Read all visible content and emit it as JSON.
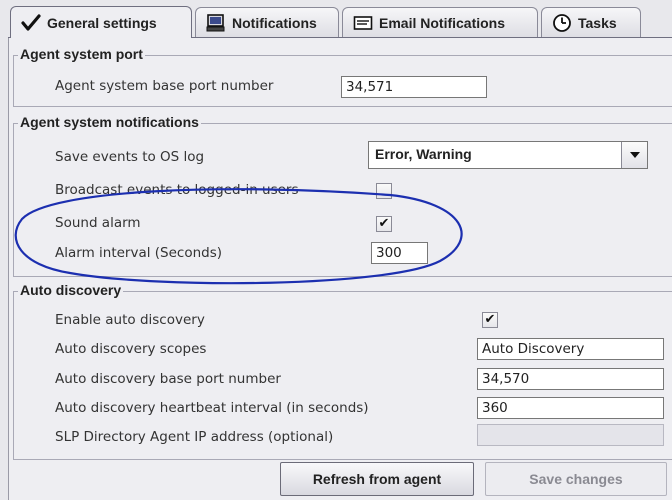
{
  "tabs": [
    {
      "label": "General settings",
      "icon": "checkmark-icon",
      "active": true
    },
    {
      "label": "Notifications",
      "icon": "computer-icon",
      "active": false
    },
    {
      "label": "Email Notifications",
      "icon": "email-icon",
      "active": false
    },
    {
      "label": "Tasks",
      "icon": "clock-icon",
      "active": false
    }
  ],
  "agent_port": {
    "title": "Agent system port",
    "base_port_label": "Agent system base port number",
    "base_port_value": "34,571"
  },
  "notifications": {
    "title": "Agent system notifications",
    "save_events_label": "Save events to OS log",
    "save_events_value": "Error, Warning",
    "broadcast_label": "Broadcast events to logged-in users",
    "broadcast_checked": false,
    "sound_alarm_label": "Sound alarm",
    "sound_alarm_checked": true,
    "alarm_interval_label": "Alarm interval (Seconds)",
    "alarm_interval_value": "300"
  },
  "auto_discovery": {
    "title": "Auto discovery",
    "enable_label": "Enable auto discovery",
    "enable_checked": true,
    "scopes_label": "Auto discovery scopes",
    "scopes_value": "Auto Discovery",
    "base_port_label": "Auto discovery base port number",
    "base_port_value": "34,570",
    "heartbeat_label": "Auto discovery heartbeat interval (in seconds)",
    "heartbeat_value": "360",
    "slp_label": "SLP Directory Agent IP address (optional)",
    "slp_value": ""
  },
  "buttons": {
    "refresh_label": "Refresh from agent",
    "save_label": "Save changes"
  },
  "colors": {
    "annotation": "#1c2fb0",
    "panel_bg": "#eeeef2"
  }
}
